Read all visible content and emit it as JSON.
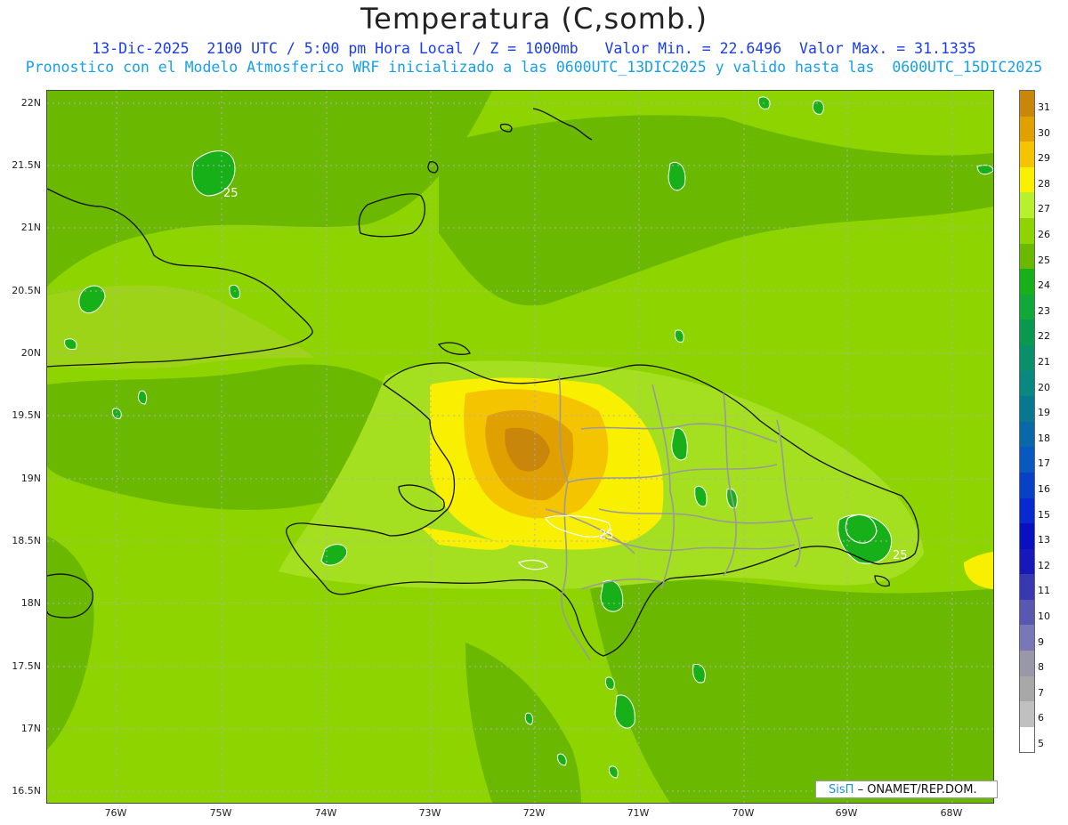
{
  "title": "Temperatura (C,somb.)",
  "subtitle_line1": "13-Dic-2025  2100 UTC / 5:00 pm Hora Local / Z = 1000mb   Valor Min. = 22.6496  Valor Max. = 31.1335",
  "subtitle_line2": "Pronostico con el Modelo Atmosferico WRF inicializado a las 0600UTC_13DIC2025 y valido hasta las  0600UTC_15DIC2025",
  "y_axis_labels": [
    "22N",
    "21.5N",
    "21N",
    "20.5N",
    "20N",
    "19.5N",
    "19N",
    "18.5N",
    "18N",
    "17.5N",
    "17N",
    "16.5N"
  ],
  "x_axis_labels": [
    "76W",
    "75W",
    "74W",
    "73W",
    "72W",
    "71W",
    "70W",
    "69W",
    "68W"
  ],
  "contour_labels": [
    "25",
    "25",
    "25"
  ],
  "colorbar": {
    "labels": [
      "31",
      "30",
      "29",
      "28",
      "27",
      "26",
      "25",
      "24",
      "23",
      "22",
      "21",
      "20",
      "19",
      "18",
      "17",
      "16",
      "15",
      "13",
      "12",
      "11",
      "10",
      "9",
      "8",
      "7",
      "6",
      "5"
    ],
    "colors": [
      "#c8860a",
      "#e0a000",
      "#f5c400",
      "#f8f000",
      "#b8f030",
      "#8ed400",
      "#6ab800",
      "#18b018",
      "#10a838",
      "#089850",
      "#08906a",
      "#088880",
      "#087890",
      "#0868a8",
      "#0858c0",
      "#0840c8",
      "#0828d0",
      "#0810c0",
      "#1818b8",
      "#3838b0",
      "#5858b0",
      "#7878b8",
      "#9898a8",
      "#a8a8a8",
      "#c0c0c0",
      "#ffffff"
    ]
  },
  "credit": {
    "sis": "SisΠ",
    "text": "– ONAMET/REP.DOM."
  },
  "colors": {
    "base_field": "#8ed400",
    "darker_field": "#6ab800",
    "light_field": "#b8f030",
    "warm_field": "#f5c400",
    "hot_field": "#e0a000",
    "hottest_field": "#c8860a",
    "cool_spot": "#18b018",
    "coast": "#111111",
    "border": "#9a9a9a"
  }
}
